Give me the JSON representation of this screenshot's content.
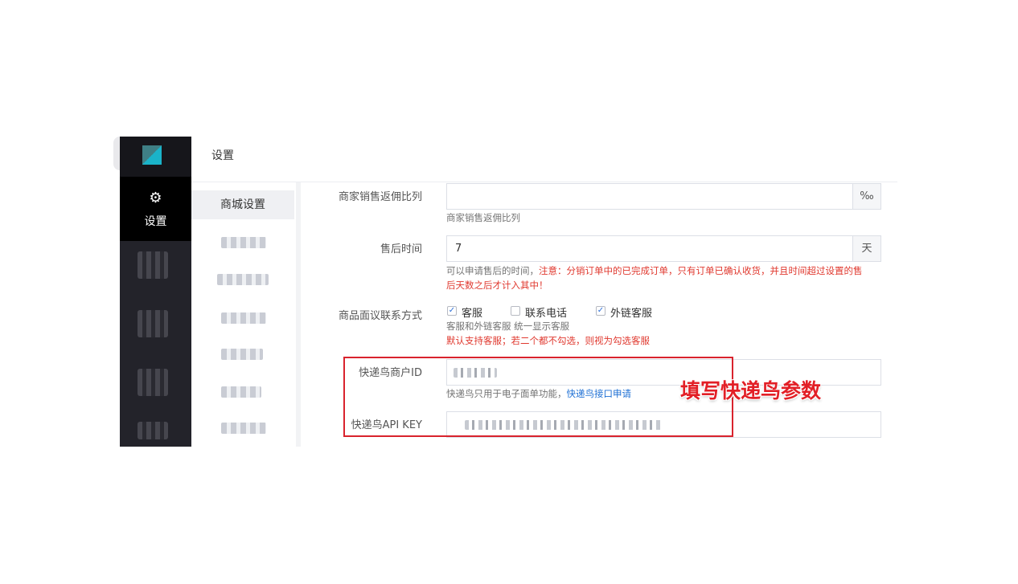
{
  "header": {
    "title": "设置"
  },
  "sidebar": {
    "active_icon": "gear-icon",
    "active_label": "设置"
  },
  "submenu": {
    "active": "商城设置"
  },
  "form": {
    "commission": {
      "label": "商家销售返佣比列",
      "value": "",
      "addon": "‰",
      "help": "商家销售返佣比列"
    },
    "aftersale": {
      "label": "售后时间",
      "value": "7",
      "addon": "天",
      "help_prefix": "可以申请售后的时间，",
      "help_warning_line1": "注意：分销订单中的已完成订单，只有订单已确认收货，并且时间超过设置的售",
      "help_warning_line2": "后天数之后才计入其中！"
    },
    "contact": {
      "label": "商品面议联系方式",
      "options": [
        {
          "label": "客服",
          "checked": true
        },
        {
          "label": "联系电话",
          "checked": false
        },
        {
          "label": "外链客服",
          "checked": true
        }
      ],
      "help": "客服和外链客服 统一显示客服",
      "help_red": "默认支持客服；若二个都不勾选，则视为勾选客服"
    },
    "kdn_id": {
      "label": "快递鸟商户ID",
      "help": "快递鸟只用于电子面单功能，",
      "link": "快递鸟接口申请"
    },
    "kdn_key": {
      "label": "快递鸟API KEY"
    }
  },
  "annotation": {
    "text": "填写快递鸟参数",
    "color": "#e21f26"
  },
  "colors": {
    "sidebar_bg": "#23232a",
    "accent_red": "#e0392f",
    "link_blue": "#1d6fd4"
  }
}
